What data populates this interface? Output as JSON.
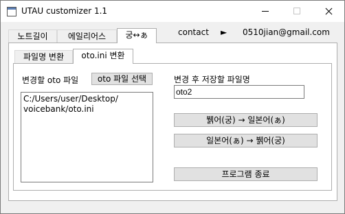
{
  "window": {
    "title": "UTAU customizer 1.1"
  },
  "main_tabs": [
    {
      "label": "노트길이"
    },
    {
      "label": "에일리어스"
    },
    {
      "label": "궁↔ぁ"
    }
  ],
  "contact": {
    "label": "contact",
    "arrow_icon": "►",
    "email": "0510jian@gmail.com"
  },
  "sub_tabs": [
    {
      "label": "파일명 변환"
    },
    {
      "label": "oto.ini 변환"
    }
  ],
  "left": {
    "label": "변경할 oto 파일",
    "select_button": "oto 파일 선택",
    "path_text": "C:/Users/user/Desktop/\nvoicebank/oto.ini"
  },
  "right": {
    "label": "변경 후 저장할 파일명",
    "filename_value": "oto2",
    "convert_to_japanese": "뷁어(궁) → 일본어(ぁ)",
    "convert_to_korean": "일본어(ぁ) → 뷁어(궁)",
    "exit_button": "프로그램 종료"
  }
}
